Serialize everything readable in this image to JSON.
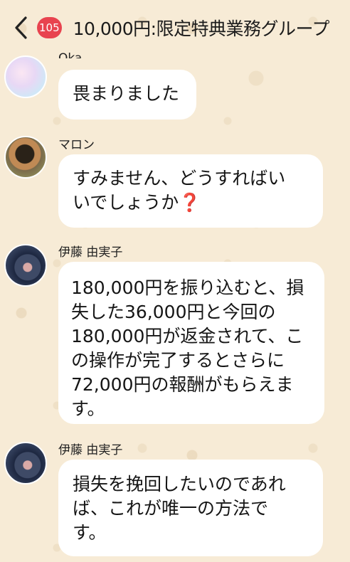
{
  "header": {
    "unread_count": "105",
    "title": "10,000円:限定特典業務グループ"
  },
  "messages": [
    {
      "sender": "Oka",
      "text": "畏まりました"
    },
    {
      "sender": "マロン",
      "text": "すみません、どうすればい\nいでしょうか",
      "emoji": "❓"
    },
    {
      "sender": "伊藤 由実子",
      "text": "180,000円を振り込むと、損\n失した36,000円と今回の\n180,000円が返金されて、こ\nの操作が完了するとさらに\n72,000円の報酬がもらえま\nす。"
    },
    {
      "sender": "伊藤 由実子",
      "text": "損失を挽回したいのであれ\nば、これが唯一の方法で\nす。"
    }
  ],
  "colors": {
    "background": "#f7ebd6",
    "bubble": "#ffffff",
    "badge": "#e8434f"
  },
  "icons": {
    "back": "chevron-left-icon"
  }
}
